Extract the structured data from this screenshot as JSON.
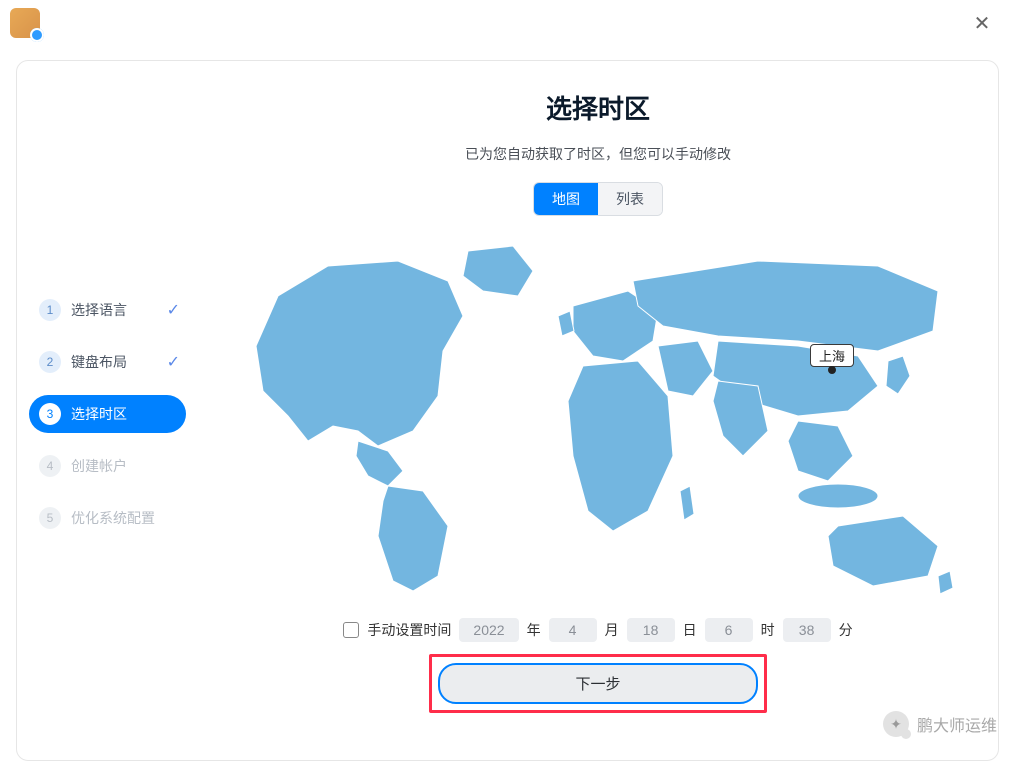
{
  "titlebar": {
    "close_glyph": "✕"
  },
  "sidebar": {
    "steps": [
      {
        "num": "1",
        "label": "选择语言",
        "state": "done"
      },
      {
        "num": "2",
        "label": "键盘布局",
        "state": "done"
      },
      {
        "num": "3",
        "label": "选择时区",
        "state": "active"
      },
      {
        "num": "4",
        "label": "创建帐户",
        "state": "future"
      },
      {
        "num": "5",
        "label": "优化系统配置",
        "state": "future"
      }
    ],
    "check_glyph": "✓"
  },
  "main": {
    "title": "选择时区",
    "subtitle": "已为您自动获取了时区，但您可以手动修改",
    "tabs": {
      "map": "地图",
      "list": "列表",
      "selected": "map"
    },
    "map_label": "上海",
    "manual_label": "手动设置时间",
    "date": {
      "year": "2022",
      "year_unit": "年",
      "month": "4",
      "month_unit": "月",
      "day": "18",
      "day_unit": "日",
      "hour": "6",
      "hour_unit": "时",
      "minute": "38",
      "minute_unit": "分"
    },
    "next": "下一步"
  },
  "watermark": "鹏大师运维"
}
